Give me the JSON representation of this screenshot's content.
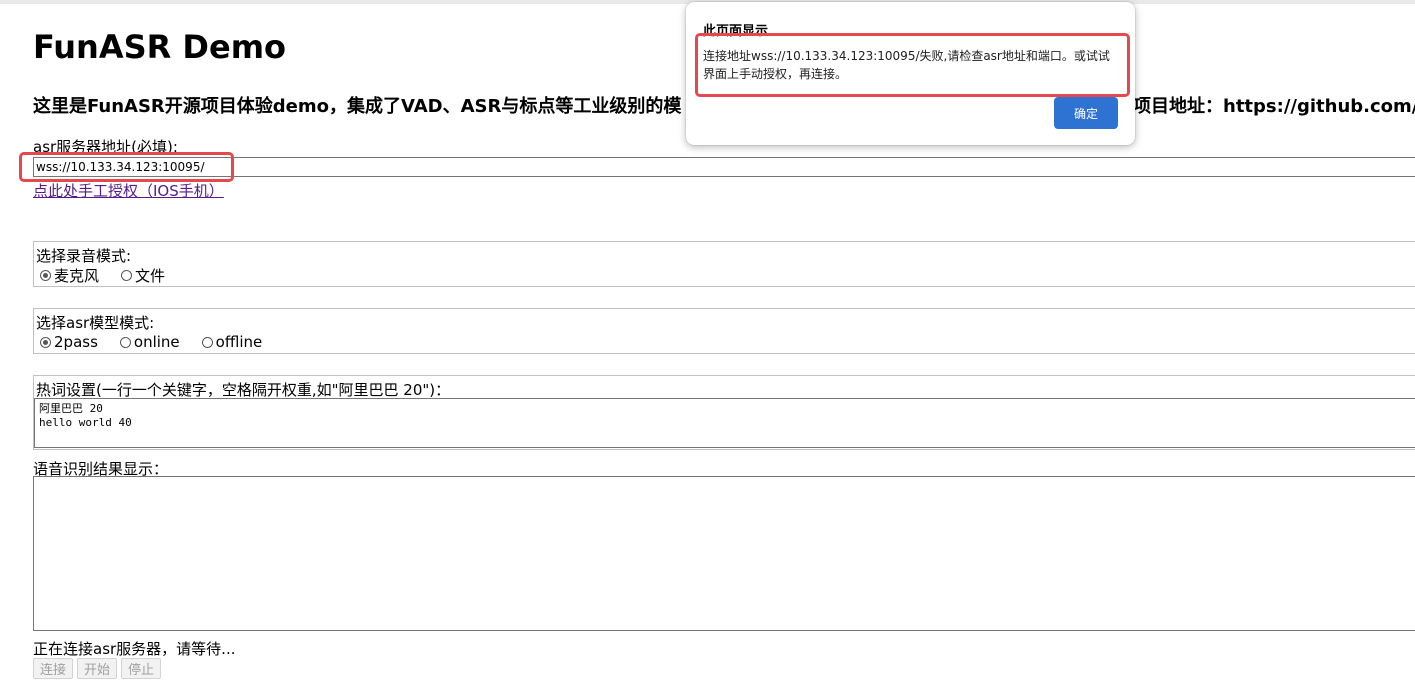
{
  "page": {
    "title": "FunASR Demo",
    "subtitle": "这里是FunASR开源项目体验demo，集成了VAD、ASR与标点等工业级别的模",
    "subtitle_right": "项目地址：https://github.com/"
  },
  "server": {
    "label": "asr服务器地址(必填):",
    "value": "wss://10.133.34.123:10095/",
    "auth_link": "点此处手工授权（IOS手机）"
  },
  "record_mode": {
    "label": "选择录音模式:",
    "options": [
      {
        "label": "麦克风",
        "checked": true
      },
      {
        "label": "文件",
        "checked": false
      }
    ]
  },
  "model_mode": {
    "label": "选择asr模型模式:",
    "options": [
      {
        "label": "2pass",
        "checked": true
      },
      {
        "label": "online",
        "checked": false
      },
      {
        "label": "offline",
        "checked": false
      }
    ]
  },
  "hotwords": {
    "label": "热词设置(一行一个关键字，空格隔开权重,如\"阿里巴巴 20\")：",
    "value": "阿里巴巴 20\nhello world 40"
  },
  "result": {
    "label": "语音识别结果显示：",
    "value": ""
  },
  "status": "正在连接asr服务器，请等待...",
  "buttons": {
    "connect": "连接",
    "start": "开始",
    "stop": "停止"
  },
  "dialog": {
    "title": "此页面显示",
    "message": "连接地址wss://10.133.34.123:10095/失败,请检查asr地址和端口。或试试界面上手动授权，再连接。",
    "ok": "确定"
  },
  "colors": {
    "highlight": "#e5484d",
    "ok_button": "#2f73d2",
    "link": "#551a8b"
  }
}
